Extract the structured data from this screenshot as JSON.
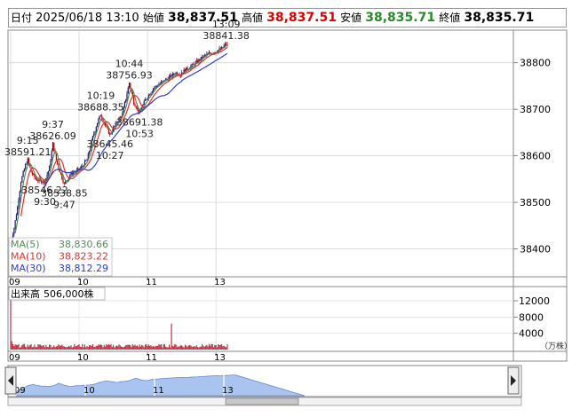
{
  "header": {
    "date_label": "日付",
    "datetime": "2025/06/18 13:10",
    "open_label": "始値",
    "open": "38,837.51",
    "high_label": "高値",
    "high": "38,837.51",
    "low_label": "安値",
    "low": "38,835.71",
    "close_label": "終値",
    "close": "38,835.71"
  },
  "colors": {
    "up": "#1a1a66",
    "down": "#c00000",
    "ma5": "#5a8a5a",
    "ma10": "#e03030",
    "ma30": "#3040c0",
    "volume_bar": "#c03040",
    "navigator_fill": "#aac4f0"
  },
  "chart_data": [
    {
      "type": "candlestick",
      "title": "",
      "x_tick_labels": [
        "09",
        "10",
        "11",
        "13"
      ],
      "y_tick_labels": [
        "38400",
        "38500",
        "38600",
        "38700",
        "38800"
      ],
      "ylim": [
        38340,
        38870
      ],
      "price_path": [
        [
          "09:00",
          38412
        ],
        [
          "09:03",
          38445
        ],
        [
          "09:06",
          38490
        ],
        [
          "09:09",
          38545
        ],
        [
          "09:13",
          38580
        ],
        [
          "09:15",
          38591.21
        ],
        [
          "09:18",
          38565
        ],
        [
          "09:22",
          38550
        ],
        [
          "09:26",
          38546
        ],
        [
          "09:30",
          38545
        ],
        [
          "09:34",
          38575
        ],
        [
          "09:37",
          38626.09
        ],
        [
          "09:40",
          38590
        ],
        [
          "09:44",
          38560
        ],
        [
          "09:47",
          38538.85
        ],
        [
          "09:52",
          38560
        ],
        [
          "09:57",
          38565
        ],
        [
          "10:02",
          38575
        ],
        [
          "10:07",
          38592
        ],
        [
          "10:12",
          38640
        ],
        [
          "10:16",
          38672
        ],
        [
          "10:19",
          38688.35
        ],
        [
          "10:23",
          38665
        ],
        [
          "10:27",
          38645.46
        ],
        [
          "10:32",
          38668
        ],
        [
          "10:38",
          38690
        ],
        [
          "10:44",
          38756.93
        ],
        [
          "10:48",
          38715
        ],
        [
          "10:53",
          38691.38
        ],
        [
          "10:58",
          38720
        ],
        [
          "11:05",
          38745
        ],
        [
          "11:15",
          38762
        ],
        [
          "11:25",
          38778
        ],
        [
          "11:30",
          38775
        ],
        [
          "12:30",
          38780
        ],
        [
          "12:40",
          38795
        ],
        [
          "12:50",
          38815
        ],
        [
          "13:00",
          38825
        ],
        [
          "13:05",
          38830
        ],
        [
          "13:09",
          38841.38
        ],
        [
          "13:10",
          38835.71
        ]
      ],
      "annotations": [
        {
          "time": "9:15",
          "value": "38591.21",
          "pos": "above"
        },
        {
          "time": "9:37",
          "value": "38626.09",
          "pos": "above"
        },
        {
          "time": "9:30",
          "value": "38546.22",
          "pos": "below"
        },
        {
          "time": "9:47",
          "value": "38538.85",
          "pos": "below"
        },
        {
          "time": "10:19",
          "value": "38688.35",
          "pos": "above"
        },
        {
          "time": "10:27",
          "value": "38645.46",
          "pos": "below"
        },
        {
          "time": "10:44",
          "value": "38756.93",
          "pos": "above"
        },
        {
          "time": "10:53",
          "value": "38691.38",
          "pos": "below"
        },
        {
          "time": "13:09",
          "value": "38841.38",
          "pos": "above"
        }
      ],
      "legend_position": "bottom-left",
      "moving_averages": [
        {
          "name": "MA(5)",
          "value": "38,830.66"
        },
        {
          "name": "MA(10)",
          "value": "38,823.22"
        },
        {
          "name": "MA(30)",
          "value": "38,812.29"
        }
      ],
      "grid": true
    },
    {
      "type": "bar",
      "title": "出来高",
      "subtitle": "506,000株",
      "y_tick_labels": [
        "4000",
        "8000",
        "12000"
      ],
      "unit": "（万株）",
      "ylim": [
        0,
        15500
      ],
      "x_tick_labels": [
        "09",
        "10",
        "11",
        "13"
      ],
      "volume_points": [
        [
          "09:00",
          14800
        ],
        [
          "09:01",
          2100
        ],
        [
          "09:02",
          1300
        ],
        [
          "11:21",
          6400
        ]
      ],
      "baseline_volume": [
        500,
        1400
      ]
    },
    {
      "type": "area",
      "title": "",
      "x_tick_labels": [
        "09",
        "10",
        "11",
        "13"
      ]
    }
  ]
}
